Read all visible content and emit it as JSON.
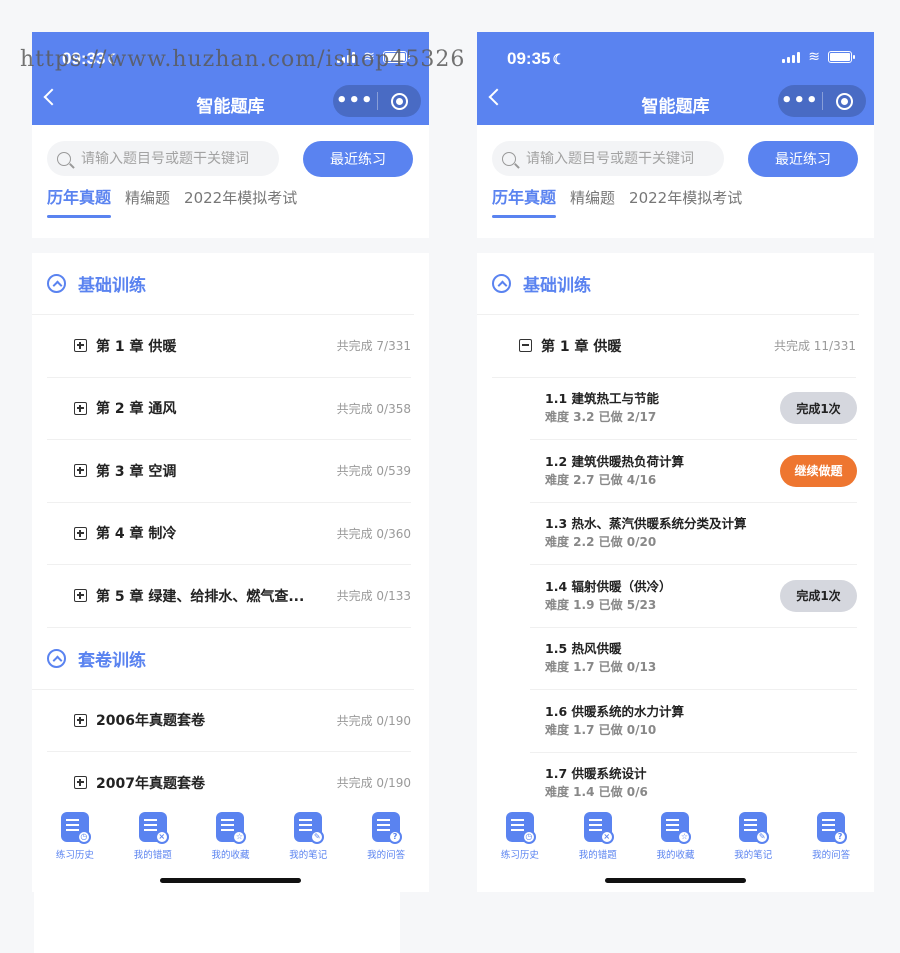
{
  "watermark": "https://www.huzhan.com/ishop45326",
  "colors": {
    "primary": "#5a83f0",
    "orange": "#ee7630",
    "done_pill": "#d5d7de"
  },
  "left": {
    "status_time": "09:33",
    "nav_title": "智能题库",
    "search_placeholder": "请输入题目号或题干关键词",
    "recent_button": "最近练习",
    "tabs": [
      "历年真题",
      "精编题",
      "2022年模拟考试"
    ],
    "sections": [
      {
        "label": "基础训练",
        "chapters": [
          {
            "title": "第 1 章 供暖",
            "stat": "共完成 7/331"
          },
          {
            "title": "第 2 章 通风",
            "stat": "共完成 0/358"
          },
          {
            "title": "第 3 章 空调",
            "stat": "共完成 0/539"
          },
          {
            "title": "第 4 章 制冷",
            "stat": "共完成 0/360"
          },
          {
            "title": "第 5 章 绿建、给排水、燃气查...",
            "stat": "共完成 0/133"
          }
        ]
      },
      {
        "label": "套卷训练",
        "chapters": [
          {
            "title": "2006年真题套卷",
            "stat": "共完成 0/190"
          },
          {
            "title": "2007年真题套卷",
            "stat": "共完成 0/190"
          }
        ]
      }
    ]
  },
  "right": {
    "status_time": "09:35",
    "nav_title": "智能题库",
    "search_placeholder": "请输入题目号或题干关键词",
    "recent_button": "最近练习",
    "tabs": [
      "历年真题",
      "精编题",
      "2022年模拟考试"
    ],
    "section_label": "基础训练",
    "chapter": {
      "title": "第 1 章 供暖",
      "stat": "共完成 11/331"
    },
    "subitems": [
      {
        "title": "1.1 建筑热工与节能",
        "meta": "难度 3.2 已做 2/17",
        "button": "完成1次",
        "button_type": "done"
      },
      {
        "title": "1.2 建筑供暖热负荷计算",
        "meta": "难度 2.7 已做 4/16",
        "button": "继续做题",
        "button_type": "go"
      },
      {
        "title": "1.3 热水、蒸汽供暖系统分类及计算",
        "meta": "难度 2.2 已做 0/20",
        "button": "",
        "button_type": ""
      },
      {
        "title": "1.4 辐射供暖（供冷）",
        "meta": "难度 1.9 已做 5/23",
        "button": "完成1次",
        "button_type": "done"
      },
      {
        "title": "1.5 热风供暖",
        "meta": "难度 1.7 已做 0/13",
        "button": "",
        "button_type": ""
      },
      {
        "title": "1.6 供暖系统的水力计算",
        "meta": "难度 1.7 已做 0/10",
        "button": "",
        "button_type": ""
      },
      {
        "title": "1.7 供暖系统设计",
        "meta": "难度 1.4 已做 0/6",
        "button": "",
        "button_type": ""
      }
    ]
  },
  "bottom_nav": [
    {
      "label": "练习历史",
      "icon": "history-icon",
      "glyph": "◷"
    },
    {
      "label": "我的错题",
      "icon": "wrong-icon",
      "glyph": "×"
    },
    {
      "label": "我的收藏",
      "icon": "favorite-icon",
      "glyph": "☆"
    },
    {
      "label": "我的笔记",
      "icon": "note-icon",
      "glyph": "✎"
    },
    {
      "label": "我的问答",
      "icon": "question-icon",
      "glyph": "?"
    }
  ]
}
